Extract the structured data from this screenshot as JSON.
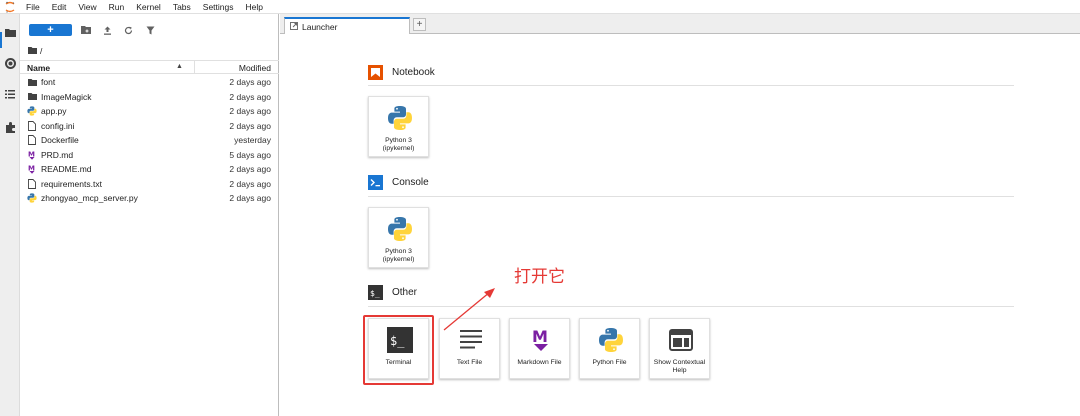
{
  "menubar": {
    "items": [
      "File",
      "Edit",
      "View",
      "Run",
      "Kernel",
      "Tabs",
      "Settings",
      "Help"
    ]
  },
  "filebrowser": {
    "new_label": "+",
    "breadcrumb": "/",
    "columns": {
      "name": "Name",
      "modified": "Modified"
    },
    "files": [
      {
        "name": "font",
        "modified": "2 days ago",
        "icon": "folder-icon"
      },
      {
        "name": "ImageMagick",
        "modified": "2 days ago",
        "icon": "folder-icon"
      },
      {
        "name": "app.py",
        "modified": "2 days ago",
        "icon": "python-file-icon"
      },
      {
        "name": "config.ini",
        "modified": "2 days ago",
        "icon": "file-icon"
      },
      {
        "name": "Dockerfile",
        "modified": "yesterday",
        "icon": "file-icon"
      },
      {
        "name": "PRD.md",
        "modified": "5 days ago",
        "icon": "markdown-icon"
      },
      {
        "name": "README.md",
        "modified": "2 days ago",
        "icon": "markdown-icon"
      },
      {
        "name": "requirements.txt",
        "modified": "2 days ago",
        "icon": "file-icon"
      },
      {
        "name": "zhongyao_mcp_server.py",
        "modified": "2 days ago",
        "icon": "python-file-icon"
      }
    ]
  },
  "tabs": [
    {
      "label": "Launcher"
    }
  ],
  "launcher": {
    "sections": {
      "notebook": {
        "title": "Notebook"
      },
      "console": {
        "title": "Console"
      },
      "other": {
        "title": "Other"
      }
    },
    "notebook_cards": [
      {
        "label": "Python 3 (ipykernel)"
      }
    ],
    "console_cards": [
      {
        "label": "Python 3 (ipykernel)"
      }
    ],
    "other_cards": [
      {
        "label": "Terminal"
      },
      {
        "label": "Text File"
      },
      {
        "label": "Markdown File"
      },
      {
        "label": "Python File"
      },
      {
        "label": "Show Contextual Help"
      }
    ]
  },
  "annotation": {
    "text": "打开它"
  },
  "colors": {
    "accent": "#1976d2",
    "annotation": "#e53935",
    "notebook": "#e65100",
    "console": "#1976d2",
    "markdown": "#7b1fa2"
  }
}
